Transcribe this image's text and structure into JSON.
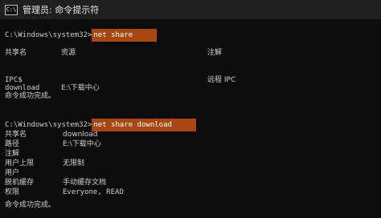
{
  "window": {
    "icon_label": "C:\\",
    "title": "管理员: 命令提示符"
  },
  "console": {
    "cmd1": {
      "prompt": "C:\\Windows\\system32>",
      "command": "net share"
    },
    "share_table": {
      "col_name": "共享名",
      "col_resource": "资源",
      "col_remark": "注解",
      "rows": [
        {
          "name": "IPC$",
          "resource": "",
          "remark": "远程 IPC"
        },
        {
          "name": "download",
          "resource": "E:\\下载中心",
          "remark": ""
        }
      ]
    },
    "success1": "命令成功完成。",
    "cmd2": {
      "prompt": "C:\\Windows\\system32>",
      "command": "net share download"
    },
    "details": [
      {
        "key": "共享名",
        "value": "download"
      },
      {
        "key": "路径",
        "value": "E:\\下载中心"
      },
      {
        "key": "注解",
        "value": ""
      },
      {
        "key": "用户上限",
        "value": "无限制"
      },
      {
        "key": "用户",
        "value": ""
      },
      {
        "key": "脱机缓存",
        "value": "手动缓存文档"
      },
      {
        "key": "权限",
        "value": "Everyone, READ"
      }
    ],
    "success2": "命令成功完成。",
    "highlight_color": "#a84612"
  }
}
